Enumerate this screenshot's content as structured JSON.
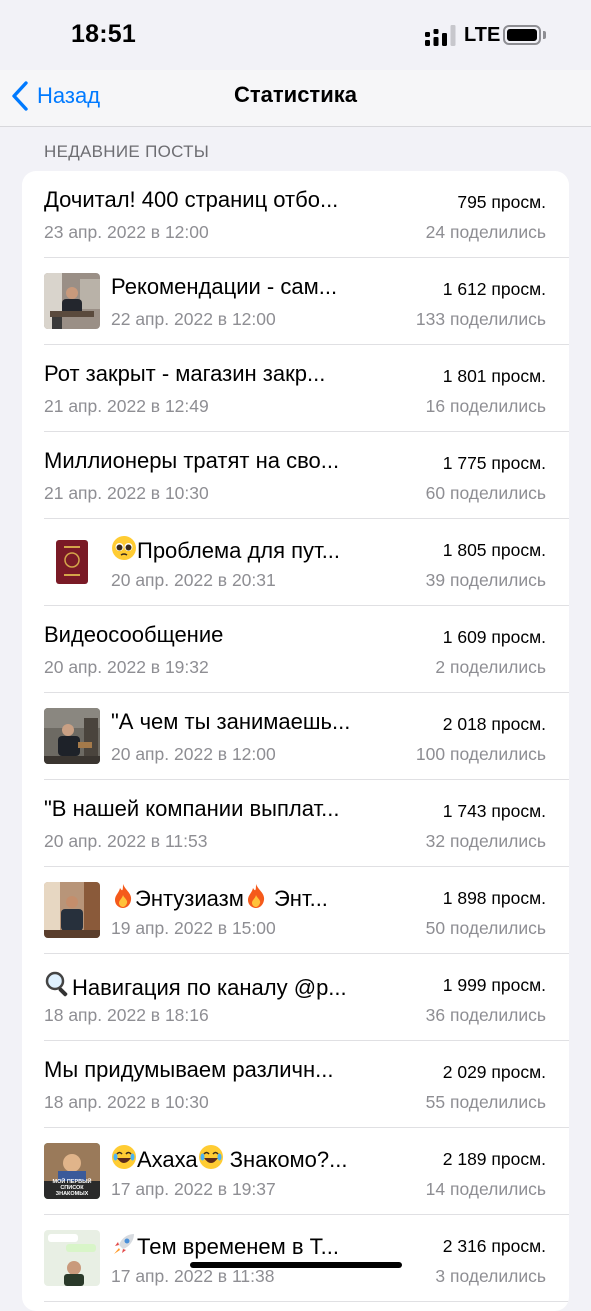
{
  "status_bar": {
    "time": "18:51",
    "network": "LTE"
  },
  "nav": {
    "back_label": "Назад",
    "title": "Статистика"
  },
  "section": {
    "header": "НЕДАВНИЕ ПОСТЫ"
  },
  "posts": [
    {
      "title": "Дочитал! 400 страниц отбо...",
      "date": "23 апр. 2022 в 12:00",
      "views": "795 просм.",
      "shares": "24 поделились",
      "thumb": null
    },
    {
      "title": "Рекомендации - сам...",
      "date": "22 апр. 2022 в 12:00",
      "views": "1 612 просм.",
      "shares": "133 поделились",
      "thumb": "photo-man-desk"
    },
    {
      "title": "Рот закрыт - магазин закр...",
      "date": "21 апр. 2022 в 12:49",
      "views": "1 801 просм.",
      "shares": "16 поделились",
      "thumb": null
    },
    {
      "title": "Миллионеры тратят на сво...",
      "date": "21 апр. 2022 в 10:30",
      "views": "1 775 просм.",
      "shares": "60 поделились",
      "thumb": null
    },
    {
      "title": "Проблема для пут...",
      "emoji": "pleading-face-icon",
      "date": "20 апр. 2022 в 20:31",
      "views": "1 805 просм.",
      "shares": "39 поделились",
      "thumb": "passport"
    },
    {
      "title": "Видеосообщение",
      "date": "20 апр. 2022 в 19:32",
      "views": "1 609 просм.",
      "shares": "2 поделились",
      "thumb": null
    },
    {
      "title": "\"А чем ты занимаешь...",
      "date": "20 апр. 2022 в 12:00",
      "views": "2 018 просм.",
      "shares": "100 поделились",
      "thumb": "photo-man-sitting"
    },
    {
      "title": "\"В нашей компании выплат...",
      "date": "20 апр. 2022 в 11:53",
      "views": "1 743 просм.",
      "shares": "32 поделились",
      "thumb": null
    },
    {
      "title": "Энтузиазм",
      "title_suffix": "Энт...",
      "emoji": "fire-icon",
      "date": "19 апр. 2022 в 15:00",
      "views": "1 898 просм.",
      "shares": "50 поделились",
      "thumb": "photo-man-room"
    },
    {
      "title": "Навигация по каналу @р...",
      "emoji": "magnifier-icon",
      "date": "18 апр. 2022 в 18:16",
      "views": "1 999 просм.",
      "shares": "36 поделились",
      "thumb": null
    },
    {
      "title": "Мы придумываем различн...",
      "date": "18 апр. 2022 в 10:30",
      "views": "2 029 просм.",
      "shares": "55 поделились",
      "thumb": null
    },
    {
      "title": "Ахаха",
      "title_suffix": "Знакомо?...",
      "emoji": "laughing-face-icon",
      "date": "17 апр. 2022 в 19:37",
      "views": "2 189 просм.",
      "shares": "14 поделились",
      "thumb": "meme",
      "thumb_caption": "МОЙ ПЕРВЫЙ СПИСОК ЗНАКОМЫХ"
    },
    {
      "title": "Тем временем в Т...",
      "emoji": "rocket-icon",
      "date": "17 апр. 2022 в 11:38",
      "views": "2 316 просм.",
      "shares": "3 поделились",
      "thumb": "photo-chat"
    }
  ],
  "colors": {
    "accent": "#007aff",
    "background": "#f2f2f7",
    "secondary_text": "#8e8e93"
  }
}
